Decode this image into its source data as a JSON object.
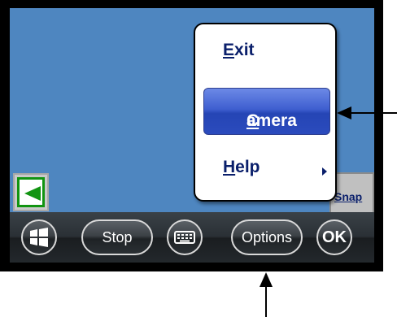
{
  "toolbar": {
    "stop_label": "Stop",
    "options_label": "Options",
    "ok_label": "OK"
  },
  "menu": {
    "items": [
      {
        "label_first": "E",
        "label_rest": "xit"
      },
      {
        "label_first": "C",
        "label_rest": "amera",
        "selected": true
      },
      {
        "label_first": "H",
        "label_rest": "elp",
        "has_submenu": true
      }
    ]
  },
  "snap": {
    "label": "Snap"
  },
  "colors": {
    "screen_bg": "#4e86c0",
    "menu_text": "#0a1f6b",
    "selection": "#3f5fd0",
    "arrow_green": "#119411"
  },
  "icons": [
    "windows-start-icon",
    "keyboard-icon",
    "left-arrow-icon",
    "submenu-right-arrow-icon"
  ]
}
